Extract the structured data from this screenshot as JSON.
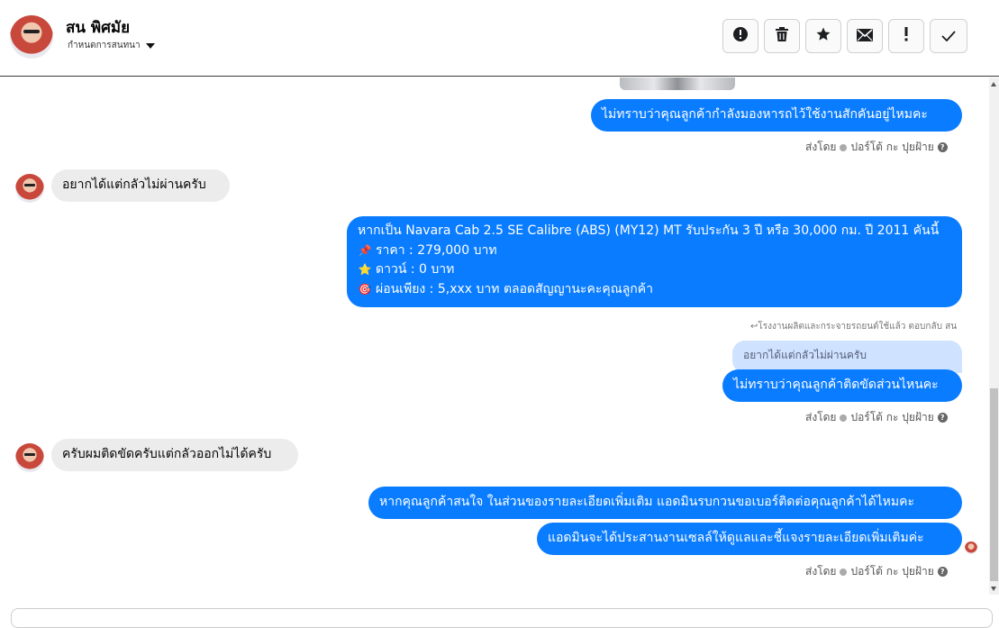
{
  "header": {
    "name": "สน พิศมัย",
    "subtitle": "กำหนดการสนทนา",
    "actions": [
      {
        "name": "report-icon",
        "glyph": "!"
      },
      {
        "name": "trash-icon",
        "glyph": ""
      },
      {
        "name": "star-icon",
        "glyph": "★"
      },
      {
        "name": "envelope-icon",
        "glyph": ""
      },
      {
        "name": "exclamation-icon",
        "glyph": "!"
      },
      {
        "name": "check-icon",
        "glyph": "✓"
      }
    ]
  },
  "messages": {
    "m1": "ไม่ทราบว่าคุณลูกค้ากำลังมองหารถไว้ใช้งานสักคันอยู่ไหมคะ",
    "sent1": {
      "prefix": "ส่งโดย",
      "agent": "ปอร์โต้ กะ ปุยฝ้าย"
    },
    "m2": "อยากได้แต่กลัวไม่ผ่านครับ",
    "m3_lines": [
      {
        "emoji": "",
        "text": "หากเป็น Navara Cab 2.5 SE Calibre (ABS) (MY12) MT รับประกัน 3 ปี หรือ 30,000 กม. ปี 2011 คันนี้"
      },
      {
        "emoji": "📌",
        "text": "ราคา : 279,000 บาท"
      },
      {
        "emoji": "⭐",
        "text": "ดาวน์ : 0 บาท"
      },
      {
        "emoji": "🎯",
        "text": "ผ่อนเพียง : 5,xxx บาท ตลอดสัญญานะคะคุณลูกค้า"
      }
    ],
    "reply_note": "โรงงานผลิตและกระจายรถยนต์ใช้แล้ว ตอบกลับ สน",
    "quoted": "อยากได้แต่กลัวไม่ผ่านครับ",
    "m4": "ไม่ทราบว่าคุณลูกค้าติดขัดส่วนไหนคะ",
    "sent2": {
      "prefix": "ส่งโดย",
      "agent": "ปอร์โต้ กะ ปุยฝ้าย"
    },
    "m5": "ครับผมติดขัดครับแต่กลัวออกไม่ได้ครับ",
    "m6": "หากคุณลูกค้าสนใจ ในส่วนของรายละเอียดเพิ่มเติม แอดมินรบกวนขอเบอร์ติดต่อคุณลูกค้าได้ไหมคะ",
    "m7": "แอดมินจะได้ประสานงานเซลล์ให้ดูแลและชี้แจงรายละเอียดเพิ่มเติมค่ะ",
    "sent3": {
      "prefix": "ส่งโดย",
      "agent": "ปอร์โต้ กะ ปุยฝ้าย"
    }
  },
  "colors": {
    "outgoing": "#0a7cff",
    "incoming": "#ececec",
    "quoted": "#cfe2ff"
  }
}
